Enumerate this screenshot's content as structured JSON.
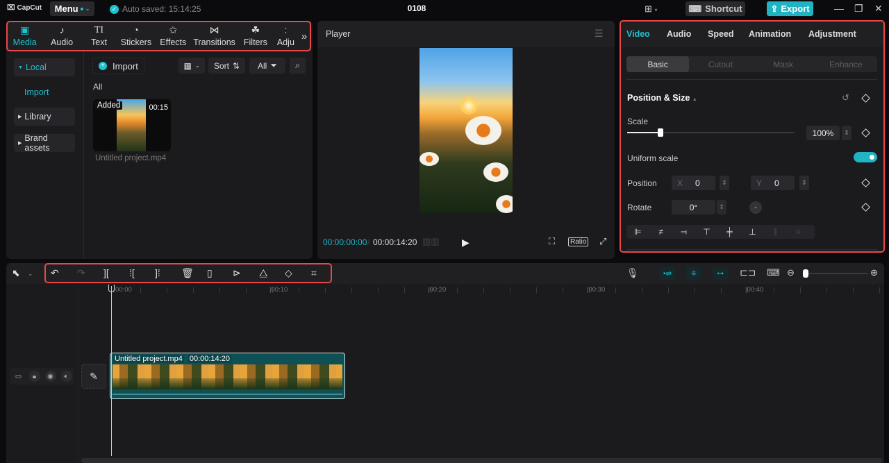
{
  "titlebar": {
    "app_name": "CapCut",
    "menu_label": "Menu",
    "autosave": "Auto saved: 15:14:25",
    "project_title": "0108",
    "shortcut_label": "Shortcut",
    "export_label": "Export"
  },
  "media_toolbar": {
    "tabs": [
      {
        "label": "Media",
        "icon": "media-icon",
        "glyph": "▣"
      },
      {
        "label": "Audio",
        "icon": "audio-icon",
        "glyph": "♪"
      },
      {
        "label": "Text",
        "icon": "text-icon",
        "glyph": "TI"
      },
      {
        "label": "Stickers",
        "icon": "sticker-icon",
        "glyph": "◔"
      },
      {
        "label": "Effects",
        "icon": "effects-icon",
        "glyph": "✩"
      },
      {
        "label": "Transitions",
        "icon": "transitions-icon",
        "glyph": "⋈"
      },
      {
        "label": "Filters",
        "icon": "filters-icon",
        "glyph": "☘"
      },
      {
        "label": "Adju",
        "icon": "adjust-icon",
        "glyph": ":"
      }
    ],
    "more_glyph": "»"
  },
  "media_sidebar": {
    "local": "Local",
    "import": "Import",
    "library": "Library",
    "brand_assets": "Brand assets"
  },
  "media_main": {
    "import_label": "Import",
    "sort_label": "Sort",
    "filter_label": "All",
    "section_label": "All",
    "items": [
      {
        "name": "Untitled project.mp4",
        "badge": "Added",
        "duration": "00:15"
      }
    ]
  },
  "player": {
    "title": "Player",
    "current_time": "00:00:00:00",
    "total_time": "00:00:14:20",
    "ratio_label": "Ratio"
  },
  "properties": {
    "tabs": [
      "Video",
      "Audio",
      "Speed",
      "Animation",
      "Adjustment"
    ],
    "active_tab": "Video",
    "subtabs": [
      "Basic",
      "Cutout",
      "Mask",
      "Enhance"
    ],
    "active_subtab": "Basic",
    "section_title": "Position & Size",
    "scale_label": "Scale",
    "scale_value": "100%",
    "scale_slider_fraction": 0.2,
    "uniform_scale_label": "Uniform scale",
    "uniform_scale_on": true,
    "position_label": "Position",
    "x_label": "X",
    "x_value": "0",
    "y_label": "Y",
    "y_value": "0",
    "rotate_label": "Rotate",
    "rotate_value": "0°"
  },
  "timeline": {
    "ruler_labels": [
      "00:00",
      "|00:10",
      "|00:20",
      "|00:30",
      "|00:40"
    ],
    "clip": {
      "name": "Untitled project.mp4",
      "duration": "00:00:14:20"
    }
  },
  "colors": {
    "accent": "#1fc1cf",
    "export_bg": "#1fb3c4",
    "highlight_border": "#e84848",
    "clip_bg": "#0d5055"
  }
}
